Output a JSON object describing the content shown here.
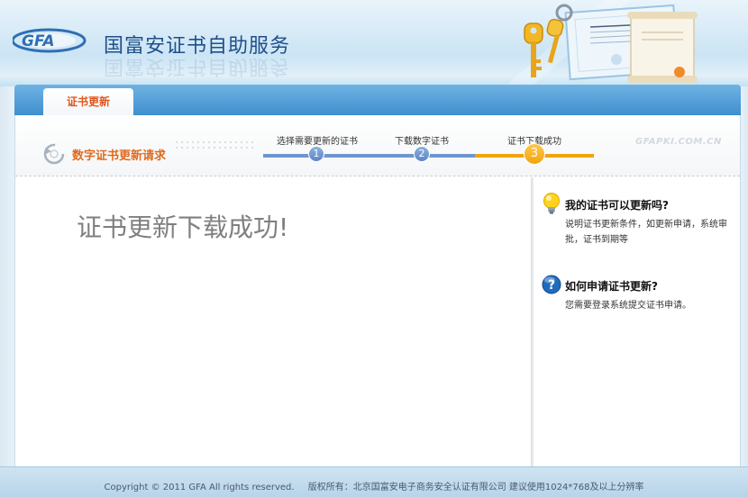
{
  "header": {
    "logo_text": "GFA",
    "title": "国富安证书自助服务"
  },
  "tabs": [
    {
      "label": "证书更新",
      "active": true
    }
  ],
  "steps_section": {
    "title": "数字证书更新请求",
    "steps": [
      {
        "number": "1",
        "label": "选择需要更新的证书",
        "state": "done"
      },
      {
        "number": "2",
        "label": "下载数字证书",
        "state": "done"
      },
      {
        "number": "3",
        "label": "证书下载成功",
        "state": "current"
      }
    ],
    "watermark": "GFAPKI.COM.CN"
  },
  "main": {
    "message": "证书更新下载成功!"
  },
  "sidebar": {
    "faqs": [
      {
        "icon": "lightbulb-icon",
        "question": "我的证书可以更新吗?",
        "answer": "说明证书更新条件，如更新申请，系统审批，证书到期等"
      },
      {
        "icon": "question-icon",
        "question": "如何申请证书更新?",
        "answer": "您需要登录系统提交证书申请。"
      }
    ]
  },
  "footer": {
    "copyright": "Copyright © 2011 GFA All rights reserved.",
    "owner": "版权所有：北京国富安电子商务安全认证有限公司 建议使用1024*768及以上分辨率"
  },
  "colors": {
    "accent_orange": "#e0561b",
    "tab_blue": "#3f8fcf",
    "step_blue": "#5b86c6",
    "step_orange": "#f2a30b"
  }
}
